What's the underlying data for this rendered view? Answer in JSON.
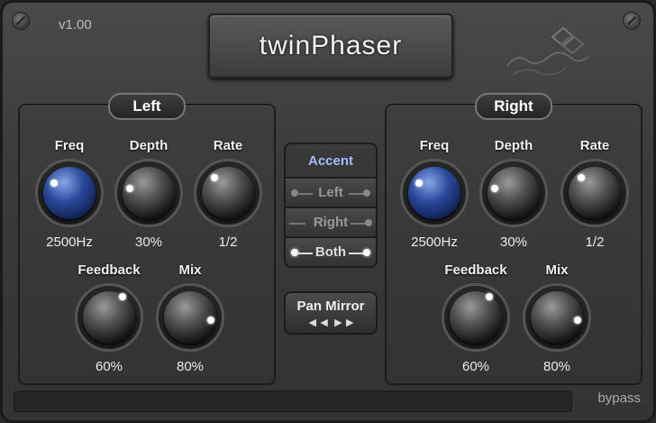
{
  "header": {
    "version": "v1.00",
    "title": "twinPhaser",
    "logo_icon": "emrp-logo-icon"
  },
  "left": {
    "label": "Left",
    "freq": {
      "label": "Freq",
      "value": "2500Hz"
    },
    "depth": {
      "label": "Depth",
      "value": "30%"
    },
    "rate": {
      "label": "Rate",
      "value": "1/2"
    },
    "feedback": {
      "label": "Feedback",
      "value": "60%"
    },
    "mix": {
      "label": "Mix",
      "value": "80%"
    }
  },
  "right": {
    "label": "Right",
    "freq": {
      "label": "Freq",
      "value": "2500Hz"
    },
    "depth": {
      "label": "Depth",
      "value": "30%"
    },
    "rate": {
      "label": "Rate",
      "value": "1/2"
    },
    "feedback": {
      "label": "Feedback",
      "value": "60%"
    },
    "mix": {
      "label": "Mix",
      "value": "80%"
    }
  },
  "accent": {
    "title": "Accent",
    "options": [
      "Left",
      "Right",
      "Both"
    ],
    "selected": "Both"
  },
  "pan_mirror": {
    "label": "Pan Mirror"
  },
  "footer": {
    "bypass": "bypass"
  },
  "colors": {
    "accent_title": "#a6b9ff",
    "freq_knob": "#2b4a9c"
  }
}
